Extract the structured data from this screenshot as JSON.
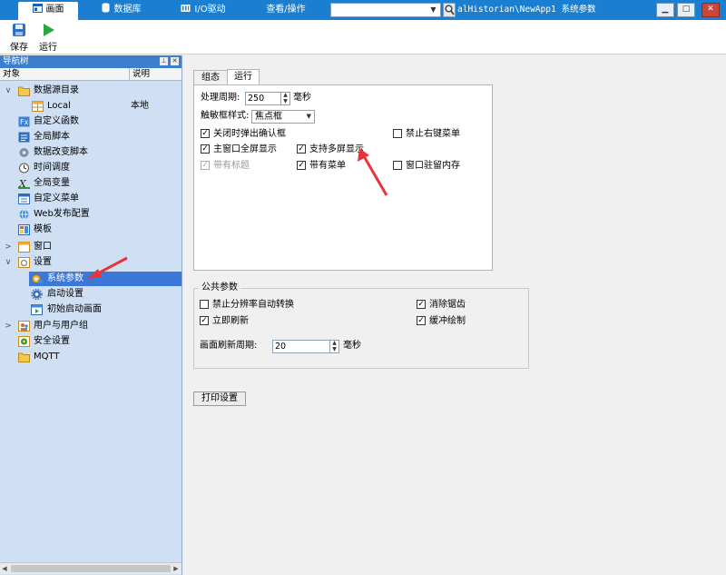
{
  "topbar": {
    "tabs": [
      {
        "label": "画面",
        "icon": "screen-icon"
      },
      {
        "label": "数据库",
        "icon": "database-icon"
      },
      {
        "label": "I/O驱动",
        "icon": "io-driver-icon"
      },
      {
        "label": "查看/操作",
        "icon": ""
      }
    ],
    "address_value": "",
    "path": "alHistorian\\NewApp1",
    "page_title": "系统参数"
  },
  "toolbar": {
    "save_label": "保存",
    "run_label": "运行"
  },
  "nav": {
    "title": "导航树",
    "col_object": "对象",
    "col_desc": "说明",
    "items": [
      {
        "label": "数据源目录",
        "icon": "folder-icon",
        "expander": "∨"
      },
      {
        "label": "Local",
        "desc": "本地",
        "icon": "database-table-icon"
      },
      {
        "label": "自定义函数",
        "icon": "function-icon"
      },
      {
        "label": "全局脚本",
        "icon": "script-icon"
      },
      {
        "label": "数据改变脚本",
        "icon": "data-change-script-icon"
      },
      {
        "label": "时间调度",
        "icon": "clock-icon"
      },
      {
        "label": "全局变量",
        "icon": "variable-icon"
      },
      {
        "label": "自定义菜单",
        "icon": "menu-icon"
      },
      {
        "label": "Web发布配置",
        "icon": "web-icon"
      },
      {
        "label": "模板",
        "icon": "template-icon"
      },
      {
        "label": "窗口",
        "icon": "window-icon",
        "expander": ">"
      },
      {
        "label": "设置",
        "icon": "settings-icon",
        "expander": "∨"
      },
      {
        "label": "系统参数",
        "icon": "system-params-icon"
      },
      {
        "label": "启动设置",
        "icon": "gear-icon"
      },
      {
        "label": "初始启动画面",
        "icon": "start-screen-icon"
      },
      {
        "label": "用户与用户组",
        "icon": "users-icon",
        "expander": ">"
      },
      {
        "label": "安全设置",
        "icon": "security-icon"
      },
      {
        "label": "MQTT",
        "icon": "folder-icon"
      }
    ]
  },
  "main": {
    "tabs": [
      "组态",
      "运行"
    ],
    "active_tab": "运行",
    "period_label": "处理周期:",
    "period_value": "250",
    "period_unit": "毫秒",
    "focus_style_label": "触敏框样式:",
    "focus_style_value": "焦点框",
    "options": [
      {
        "label": "关闭时弹出确认框",
        "checked": true
      },
      {
        "label": "禁止右键菜单",
        "checked": false
      },
      {
        "label": "主窗口全屏显示",
        "checked": true
      },
      {
        "label": "支持多屏显示",
        "checked": true
      },
      {
        "label": "带有标题",
        "checked": true,
        "disabled": true
      },
      {
        "label": "带有菜单",
        "checked": true
      },
      {
        "label": "窗口驻留内存",
        "checked": false
      }
    ],
    "public": {
      "title": "公共参数",
      "options": [
        {
          "label": "禁止分辨率自动转换",
          "checked": false
        },
        {
          "label": "消除锯齿",
          "checked": true
        },
        {
          "label": "立即刷新",
          "checked": true
        },
        {
          "label": "缓冲绘制",
          "checked": true
        }
      ],
      "refresh_label": "画面刷新周期:",
      "refresh_value": "20",
      "refresh_unit": "毫秒"
    },
    "print_button": "打印设置"
  },
  "colors": {
    "titlebar": "#1b7fd1",
    "nav_bg": "#cfe0f4",
    "selection": "#3b78d8",
    "annotation_arrow": "#e8333a"
  }
}
